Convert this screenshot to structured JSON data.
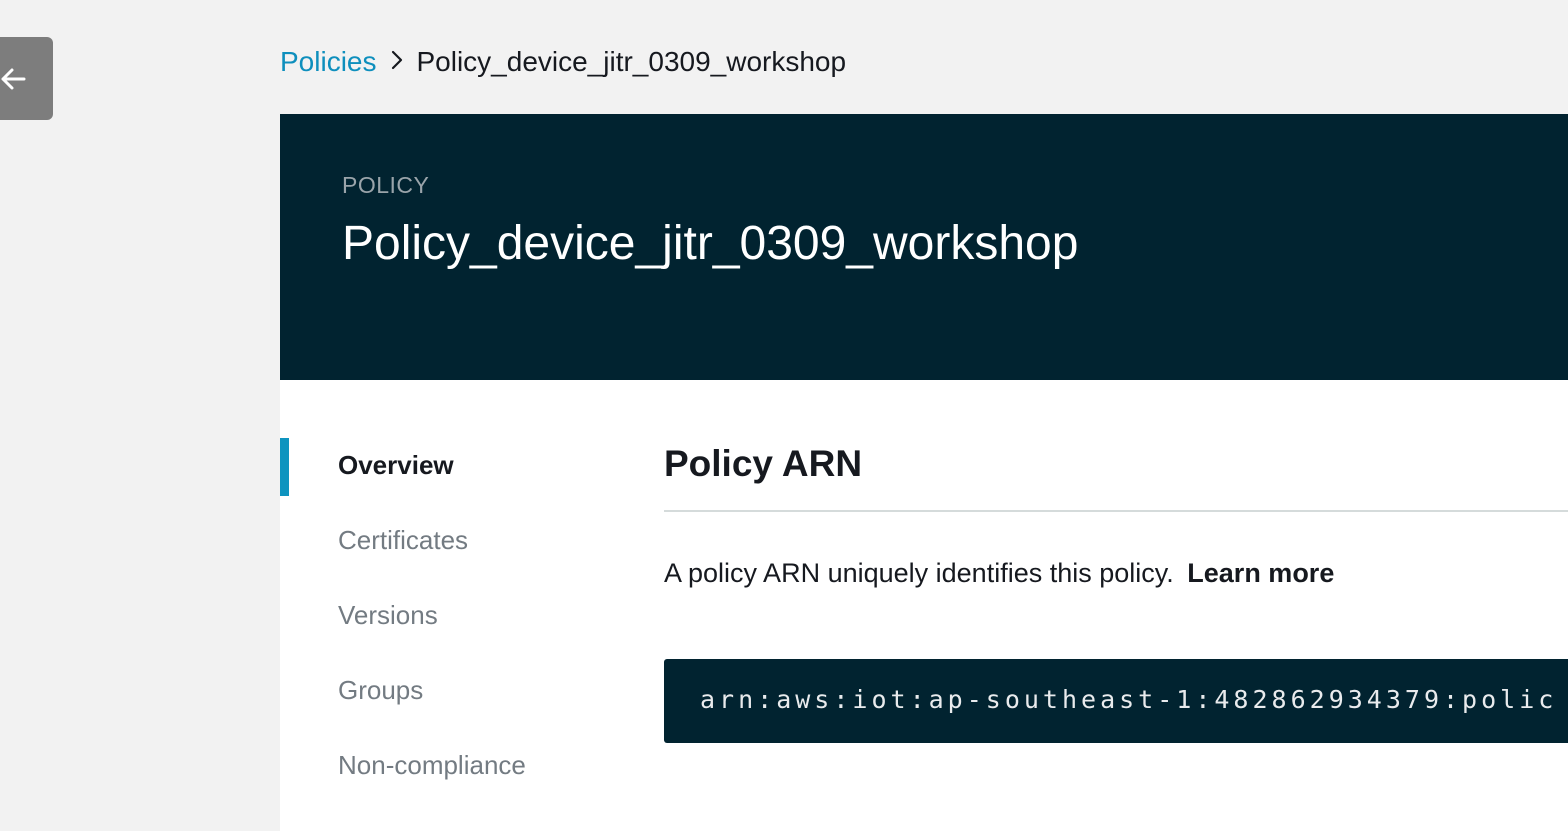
{
  "back_button": {
    "icon": "arrow-left-icon"
  },
  "breadcrumb": {
    "parent": "Policies",
    "current": "Policy_device_jitr_0309_workshop"
  },
  "header": {
    "kicker": "POLICY",
    "title": "Policy_device_jitr_0309_workshop"
  },
  "nav": {
    "items": [
      {
        "label": "Overview",
        "active": true
      },
      {
        "label": "Certificates",
        "active": false
      },
      {
        "label": "Versions",
        "active": false
      },
      {
        "label": "Groups",
        "active": false
      },
      {
        "label": "Non-compliance",
        "active": false
      }
    ]
  },
  "overview": {
    "title": "Policy ARN",
    "description": "A policy ARN uniquely identifies this policy.",
    "learn_more": "Learn more",
    "arn": "arn:aws:iot:ap-southeast-1:482862934379:polic"
  },
  "colors": {
    "banner": "#012330",
    "link": "#0e8fbd",
    "active_indicator": "#0e94bf"
  }
}
